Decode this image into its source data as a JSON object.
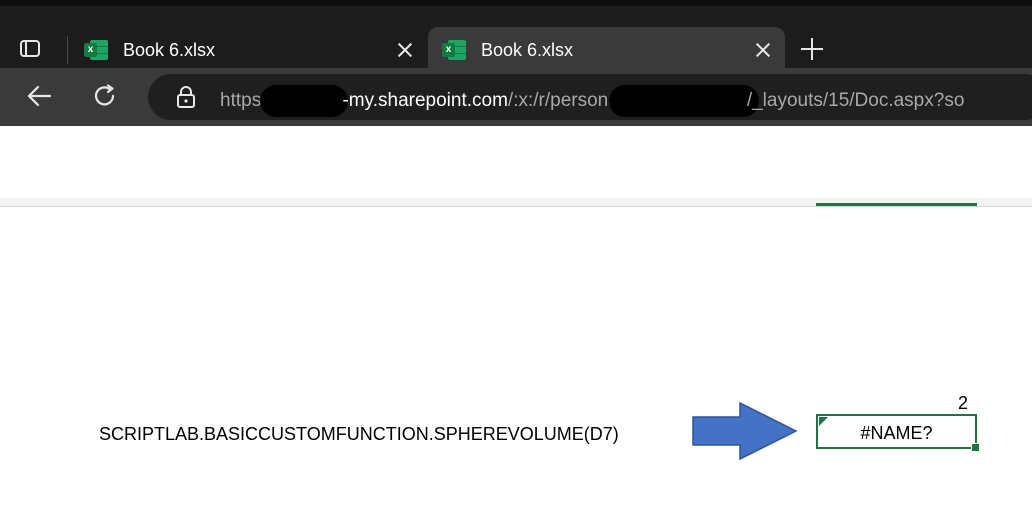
{
  "browser": {
    "tabs": [
      {
        "title": "Book 6.xlsx",
        "icon": "excel-icon",
        "active": false
      },
      {
        "title": "Book 6.xlsx",
        "icon": "excel-icon",
        "active": true
      }
    ],
    "address": {
      "scheme_prefix": "https:",
      "host": "-my.sharepoint.com",
      "path_before_redaction": "/:x:/r/persona",
      "path_after_redaction": "/_layouts/15/Doc.aspx?so"
    }
  },
  "sheet": {
    "formula_text": "SCRIPTLAB.BASICCUSTOMFUNCTION.SPHEREVOLUME(D7)",
    "cell_label": "2",
    "cell_value": "#NAME?",
    "accent_color": "#217346",
    "arrow_color": "#4472c4"
  }
}
